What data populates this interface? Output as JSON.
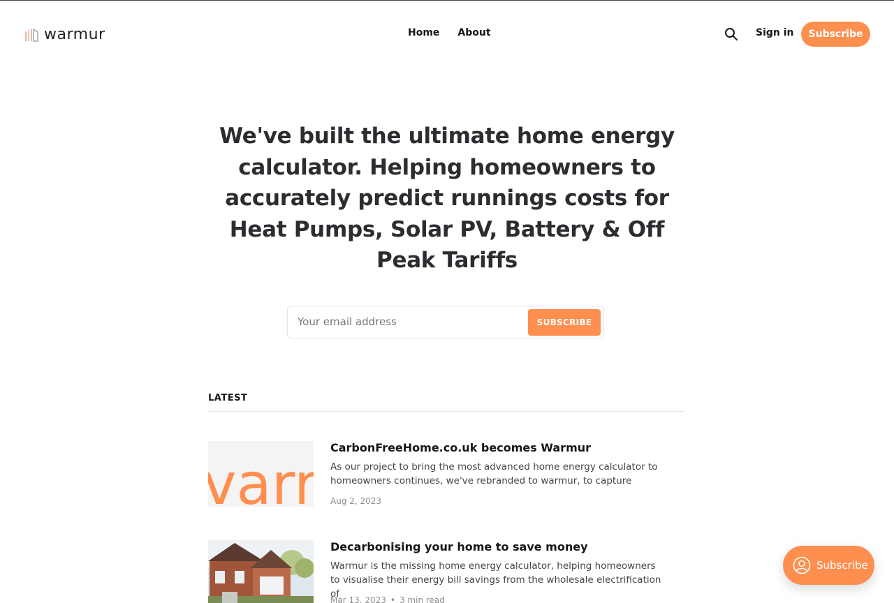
{
  "header": {
    "logo_text": "warmur",
    "nav": [
      {
        "label": "Home"
      },
      {
        "label": "About"
      }
    ],
    "search_icon": "search-icon",
    "signin_label": "Sign in",
    "subscribe_label": "Subscribe"
  },
  "hero": {
    "title": "We've built the ultimate home energy calculator. Helping homeowners to accurately predict runnings costs for Heat Pumps, Solar PV, Battery & Off Peak Tariffs",
    "email_placeholder": "Your email address",
    "subscribe_button": "SUBSCRIBE"
  },
  "latest": {
    "label": "LATEST",
    "posts": [
      {
        "title": "CarbonFreeHome.co.uk becomes Warmur",
        "excerpt": "As our project to bring the most advanced home energy calculator to homeowners continues, we've rebranded to warmur, to capture",
        "date": "Aug 2, 2023",
        "thumb_text": "varr"
      },
      {
        "title": "Decarbonising your home to save money",
        "excerpt": "Warmur is the missing home energy calculator, helping homeowners to visualise their energy bill savings from the wholesale electrification of",
        "date": "Mar 13, 2023",
        "read_time": "3 min read"
      }
    ]
  },
  "portal": {
    "label": "Subscribe",
    "icon": "user-icon"
  },
  "colors": {
    "accent": "#fe8f4f",
    "text": "#15171a"
  }
}
